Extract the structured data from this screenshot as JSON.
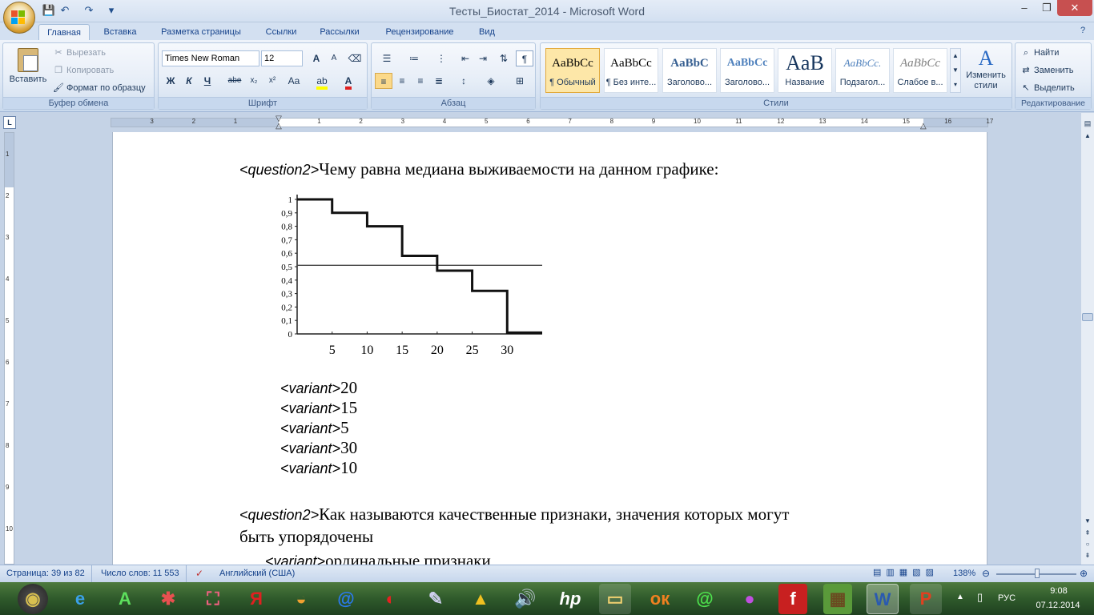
{
  "window": {
    "title": "Тесты_Биостат_2014 - Microsoft Word",
    "controls": [
      "–",
      "❐",
      "✕"
    ]
  },
  "qat": {
    "save": "💾",
    "undo": "↶",
    "redo": "↷",
    "more": "▾"
  },
  "tabs": [
    "Главная",
    "Вставка",
    "Разметка страницы",
    "Ссылки",
    "Рассылки",
    "Рецензирование",
    "Вид"
  ],
  "ribbon": {
    "clipboard": {
      "label": "Буфер обмена",
      "paste": "Вставить",
      "cut": "Вырезать",
      "copy": "Копировать",
      "format_painter": "Формат по образцу"
    },
    "font": {
      "label": "Шрифт",
      "family": "Times New Roman",
      "size": "12",
      "bold": "Ж",
      "italic": "К",
      "underline": "Ч",
      "strike": "abe",
      "subscript": "x₂",
      "superscript": "x²",
      "case": "Aa",
      "grow": "A",
      "shrink": "A"
    },
    "paragraph": {
      "label": "Абзац"
    },
    "styles": {
      "label": "Стили",
      "items": [
        {
          "sample": "AaBbCc",
          "name": "¶ Обычный"
        },
        {
          "sample": "AaBbCc",
          "name": "¶ Без инте..."
        },
        {
          "sample": "AaBbC",
          "name": "Заголово..."
        },
        {
          "sample": "AaBbCc",
          "name": "Заголово..."
        },
        {
          "sample": "AaB",
          "name": "Название"
        },
        {
          "sample": "AaBbCc.",
          "name": "Подзагол..."
        },
        {
          "sample": "AaBbCc",
          "name": "Слабое в..."
        }
      ],
      "change": "Изменить стили"
    },
    "editing": {
      "label": "Редактирование",
      "find": "Найти",
      "replace": "Заменить",
      "select": "Выделить"
    }
  },
  "ruler": {
    "h_numbers": [
      "3",
      "2",
      "1",
      "1",
      "2",
      "3",
      "4",
      "5",
      "6",
      "7",
      "8",
      "9",
      "10",
      "11",
      "12",
      "13",
      "14",
      "15",
      "16",
      "17"
    ],
    "v_numbers": [
      "1",
      "2",
      "3",
      "4",
      "5",
      "6",
      "7",
      "8",
      "9",
      "10",
      "11"
    ]
  },
  "document": {
    "q1_tag": "<question2>",
    "q1_text": "Чему равна медиана выживаемости на данном графике:",
    "variants": [
      {
        "tag": "<variant>",
        "text": "20"
      },
      {
        "tag": "<variant>",
        "text": "15"
      },
      {
        "tag": "<variant>",
        "text": "5"
      },
      {
        "tag": "<variant>",
        "text": "30"
      },
      {
        "tag": "<variant>",
        "text": "10"
      }
    ],
    "q2_tag": "<question2>",
    "q2_line1": "Как называются качественные признаки, значения которых могут",
    "q2_line2": "быть упорядочены",
    "q2_variant_tag": "<variant>",
    "q2_variant_text": "ординальные признаки"
  },
  "chart_data": {
    "type": "line",
    "step": true,
    "x_ticks": [
      "5",
      "10",
      "15",
      "20",
      "25",
      "30"
    ],
    "y_ticks": [
      "0",
      "0,1",
      "0,2",
      "0,3",
      "0,4",
      "0,5",
      "0,6",
      "0,7",
      "0,8",
      "0,9",
      "1"
    ],
    "xlim": [
      0,
      35
    ],
    "ylim": [
      0,
      1
    ],
    "series": [
      {
        "x": [
          0,
          5,
          5,
          10,
          10,
          15,
          15,
          20,
          20,
          25,
          25,
          30,
          30,
          35
        ],
        "values": [
          1,
          1,
          0.9,
          0.9,
          0.8,
          0.8,
          0.58,
          0.58,
          0.47,
          0.47,
          0.32,
          0.32,
          0.01,
          0.01
        ]
      }
    ],
    "reference_line": {
      "y": 0.51
    },
    "title": "",
    "xlabel": "",
    "ylabel": ""
  },
  "status": {
    "page": "Страница: 39 из 82",
    "words": "Число слов: 11 553",
    "language": "Английский (США)",
    "zoom": "138%"
  },
  "taskbar": {
    "language": "РУС",
    "time": "9:08",
    "date": "07.12.2014"
  }
}
